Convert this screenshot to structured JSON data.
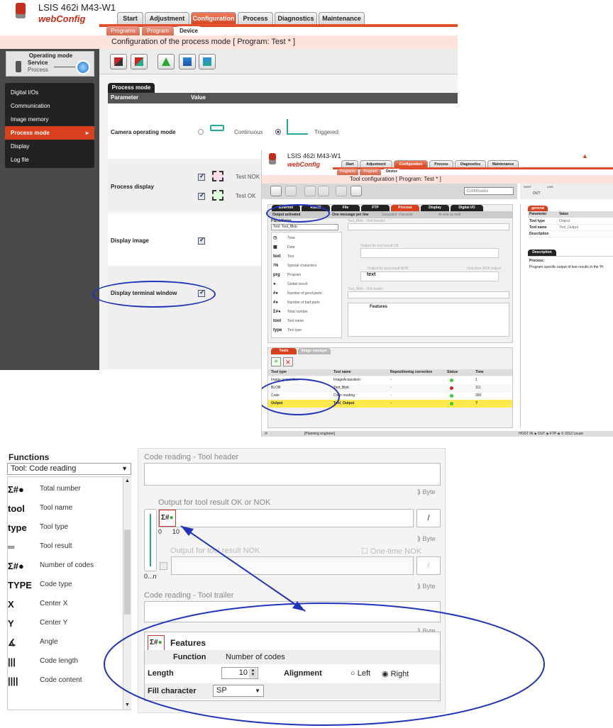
{
  "app": {
    "product": "LSIS 462i M43-W1",
    "brand": "webConfig"
  },
  "main_tabs": [
    "Start",
    "Adjustment",
    "Configuration",
    "Process",
    "Diagnostics",
    "Maintenance"
  ],
  "sub_tabs": [
    "Programs",
    "Program",
    "Device"
  ],
  "page_title": "Configuration of the process mode   [ Program: Test * ]",
  "operating_mode": {
    "title": "Operating mode",
    "service": "Service",
    "process": "Process"
  },
  "menu": [
    "Digital I/Os",
    "Communication",
    "Image memory",
    "Process mode",
    "Display",
    "Log file"
  ],
  "process_mode": {
    "tab": "Process mode",
    "col_parameter": "Parameter",
    "col_value": "Value",
    "rows": {
      "camera_mode": "Camera operating mode",
      "continuous": "Continuous",
      "triggered": "Triggered",
      "process_display": "Process display",
      "test_nok": "Test NOK",
      "test_ok": "Test OK",
      "display_image": "Display image",
      "display_terminal": "Display terminal window"
    }
  },
  "win2": {
    "product": "LSIS 462i M43-W1",
    "brand": "webConfig",
    "tabs": [
      "Start",
      "Adjustment",
      "Configuration",
      "Process",
      "Diagnostics",
      "Maintenance"
    ],
    "sub_tabs": [
      "Programs",
      "Program",
      "Device"
    ],
    "title": "Tool configuration   [ Program: Test * ]",
    "mode_select": "Continuous",
    "iface_tabs": [
      "Ethernet",
      "RS232",
      "File",
      "FTP",
      "Process",
      "Display",
      "Digital I/O"
    ],
    "output_activated": "Output activated",
    "one_message": "One message per line",
    "separator": "Separator character",
    "at_end": "At end as well",
    "functions_label": "Functions",
    "functions_select": "Tool: Tool_Blob",
    "header_label": "Tool_Blob - Tool header",
    "out_ok": "Output for tool result OK",
    "out_nok": "Output for tool result NOK",
    "one_time_nok": "One-time NOK output",
    "trailer": "Tool_Blob - Tool trailer",
    "features": "Features",
    "text_token": "text",
    "byte": "Byte",
    "fn_items": [
      {
        "icon": "◷",
        "label": "Time"
      },
      {
        "icon": "▦",
        "label": "Date"
      },
      {
        "icon": "text",
        "label": "Text"
      },
      {
        "icon": "!%",
        "label": "Special characters"
      },
      {
        "icon": "prg",
        "label": "Program"
      },
      {
        "icon": "●",
        "label": "Global result"
      },
      {
        "icon": "#●",
        "label": "Number of good parts"
      },
      {
        "icon": "#●",
        "label": "Number of bad parts"
      },
      {
        "icon": "Σ#●",
        "label": "Total number"
      },
      {
        "icon": "tool",
        "label": "Tool name"
      },
      {
        "icon": "type",
        "label": "Tool type"
      }
    ],
    "tools_tabs": [
      "Tools",
      "Image manager"
    ],
    "tools_cols": [
      "Tool type",
      "Tool name",
      "Repositioning correction",
      "Status",
      "Time"
    ],
    "tools_rows": [
      {
        "type": "Image acquisition",
        "name": "ImageAcquisition",
        "rep": "-",
        "status": "green",
        "time": "1"
      },
      {
        "type": "BLOB",
        "name": "Tool_Blob",
        "rep": "-",
        "status": "red",
        "time": "111"
      },
      {
        "type": "Code",
        "name": "Code reading",
        "rep": "-",
        "status": "green",
        "time": "350"
      },
      {
        "type": "Output",
        "name": "Tool_Output",
        "rep": "-",
        "status": "green",
        "time": "?"
      }
    ],
    "side": {
      "tab": "general",
      "col_param": "Parameter",
      "col_value": "Value",
      "rows": [
        [
          "Tool type",
          "Output"
        ],
        [
          "Tool name",
          "Tool_Output"
        ],
        [
          "Description",
          ""
        ]
      ],
      "desc_tab": "Description",
      "desc_title": "Process:",
      "desc_text": "Program-specific output of test results in the 'Pr"
    },
    "host_labels": {
      "host": "HOST",
      "lsis": "LSIS",
      "out": "OUT"
    },
    "status_left": "[Planning engineer]",
    "status_right": "HOST IN ◈ OUT ◈ FTP ◈   © 2012 Leuze"
  },
  "functions_panel": {
    "title": "Functions",
    "select": "Tool: Code reading",
    "items": [
      {
        "icon": "Σ#●",
        "label": "Total number"
      },
      {
        "icon": "tool",
        "label": "Tool name"
      },
      {
        "icon": "type",
        "label": "Tool type"
      },
      {
        "icon": "═",
        "label": "Tool result"
      },
      {
        "icon": "Σ#●",
        "label": "Number of codes"
      },
      {
        "icon": "TYPE",
        "label": "Code type"
      },
      {
        "icon": "X",
        "label": "Center X"
      },
      {
        "icon": "Y",
        "label": "Center Y"
      },
      {
        "icon": "∡",
        "label": "Angle"
      },
      {
        "icon": "|||",
        "label": "Code length"
      },
      {
        "icon": "||||",
        "label": "Code content"
      }
    ],
    "header_label": "Code reading - Tool header",
    "byte": "Byte",
    "out_ok": "Output for tool result OK or NOK",
    "out_nok": "Output for tool result NOK",
    "one_time_nok": "One-time NOK output",
    "slash": "/",
    "scale_0": "0",
    "scale_10": "10",
    "scale_n": "0...n",
    "trailer_label": "Code reading - Tool trailer",
    "features": {
      "title": "Features",
      "function_label": "Function",
      "function_value": "Number of codes",
      "length_label": "Length",
      "length_value": "10",
      "alignment_label": "Alignment",
      "left": "Left",
      "right": "Right",
      "fill_label": "Fill character",
      "fill_value": "SP"
    }
  },
  "colors": {
    "accent": "#d9401e",
    "annotation": "#2233bb"
  }
}
